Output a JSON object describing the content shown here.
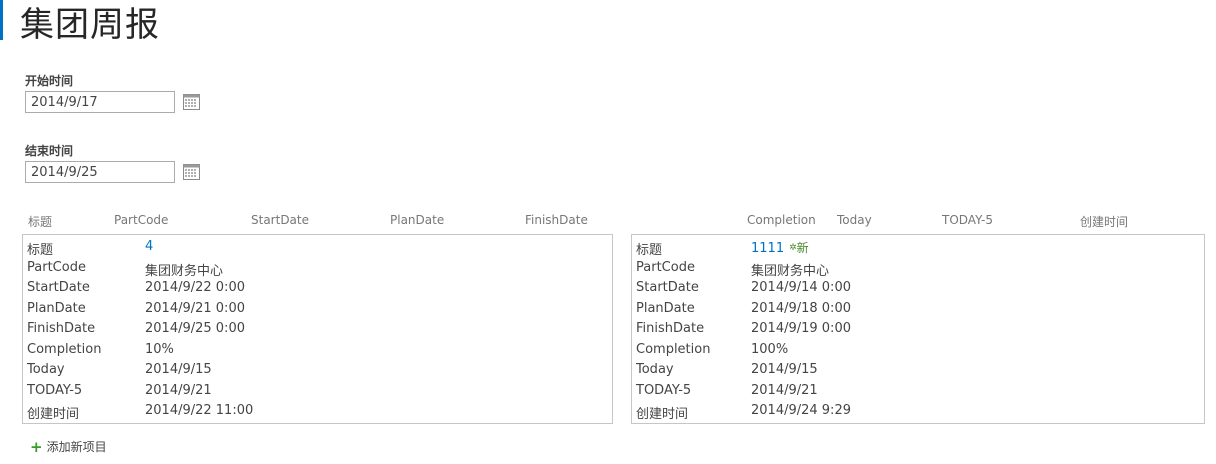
{
  "page": {
    "title": "集团周报"
  },
  "filters": {
    "start": {
      "label": "开始时间",
      "value": "2014/9/17"
    },
    "end": {
      "label": "结束时间",
      "value": "2014/9/25"
    }
  },
  "columns": [
    "标题",
    "PartCode",
    "StartDate",
    "PlanDate",
    "FinishDate",
    "Completion",
    "Today",
    "TODAY-5",
    "创建时间"
  ],
  "cards": [
    {
      "labels": [
        "标题",
        "PartCode",
        "StartDate",
        "PlanDate",
        "FinishDate",
        "Completion",
        "Today",
        "TODAY-5",
        "创建时间"
      ],
      "title": "4",
      "badge": "",
      "partcode": "集团财务中心",
      "startdate": "2014/9/22 0:00",
      "plandate": "2014/9/21 0:00",
      "finishdate": "2014/9/25 0:00",
      "completion": "10%",
      "today": "2014/9/15",
      "today5": "2014/9/21",
      "created": "2014/9/22 11:00"
    },
    {
      "labels": [
        "标题",
        "PartCode",
        "StartDate",
        "PlanDate",
        "FinishDate",
        "Completion",
        "Today",
        "TODAY-5",
        "创建时间"
      ],
      "title": "1111",
      "badge": "新",
      "partcode": "集团财务中心",
      "startdate": "2014/9/14 0:00",
      "plandate": "2014/9/18 0:00",
      "finishdate": "2014/9/19 0:00",
      "completion": "100%",
      "today": "2014/9/15",
      "today5": "2014/9/21",
      "created": "2014/9/24 9:29"
    }
  ],
  "footer": {
    "add_label": "添加新项目"
  },
  "colors": {
    "accent": "#0072c6",
    "link": "#0072c6",
    "new_badge": "#4a8a2a"
  },
  "icons": {
    "calendar": "calendar-icon",
    "add": "plus-icon",
    "new": "star-icon"
  }
}
